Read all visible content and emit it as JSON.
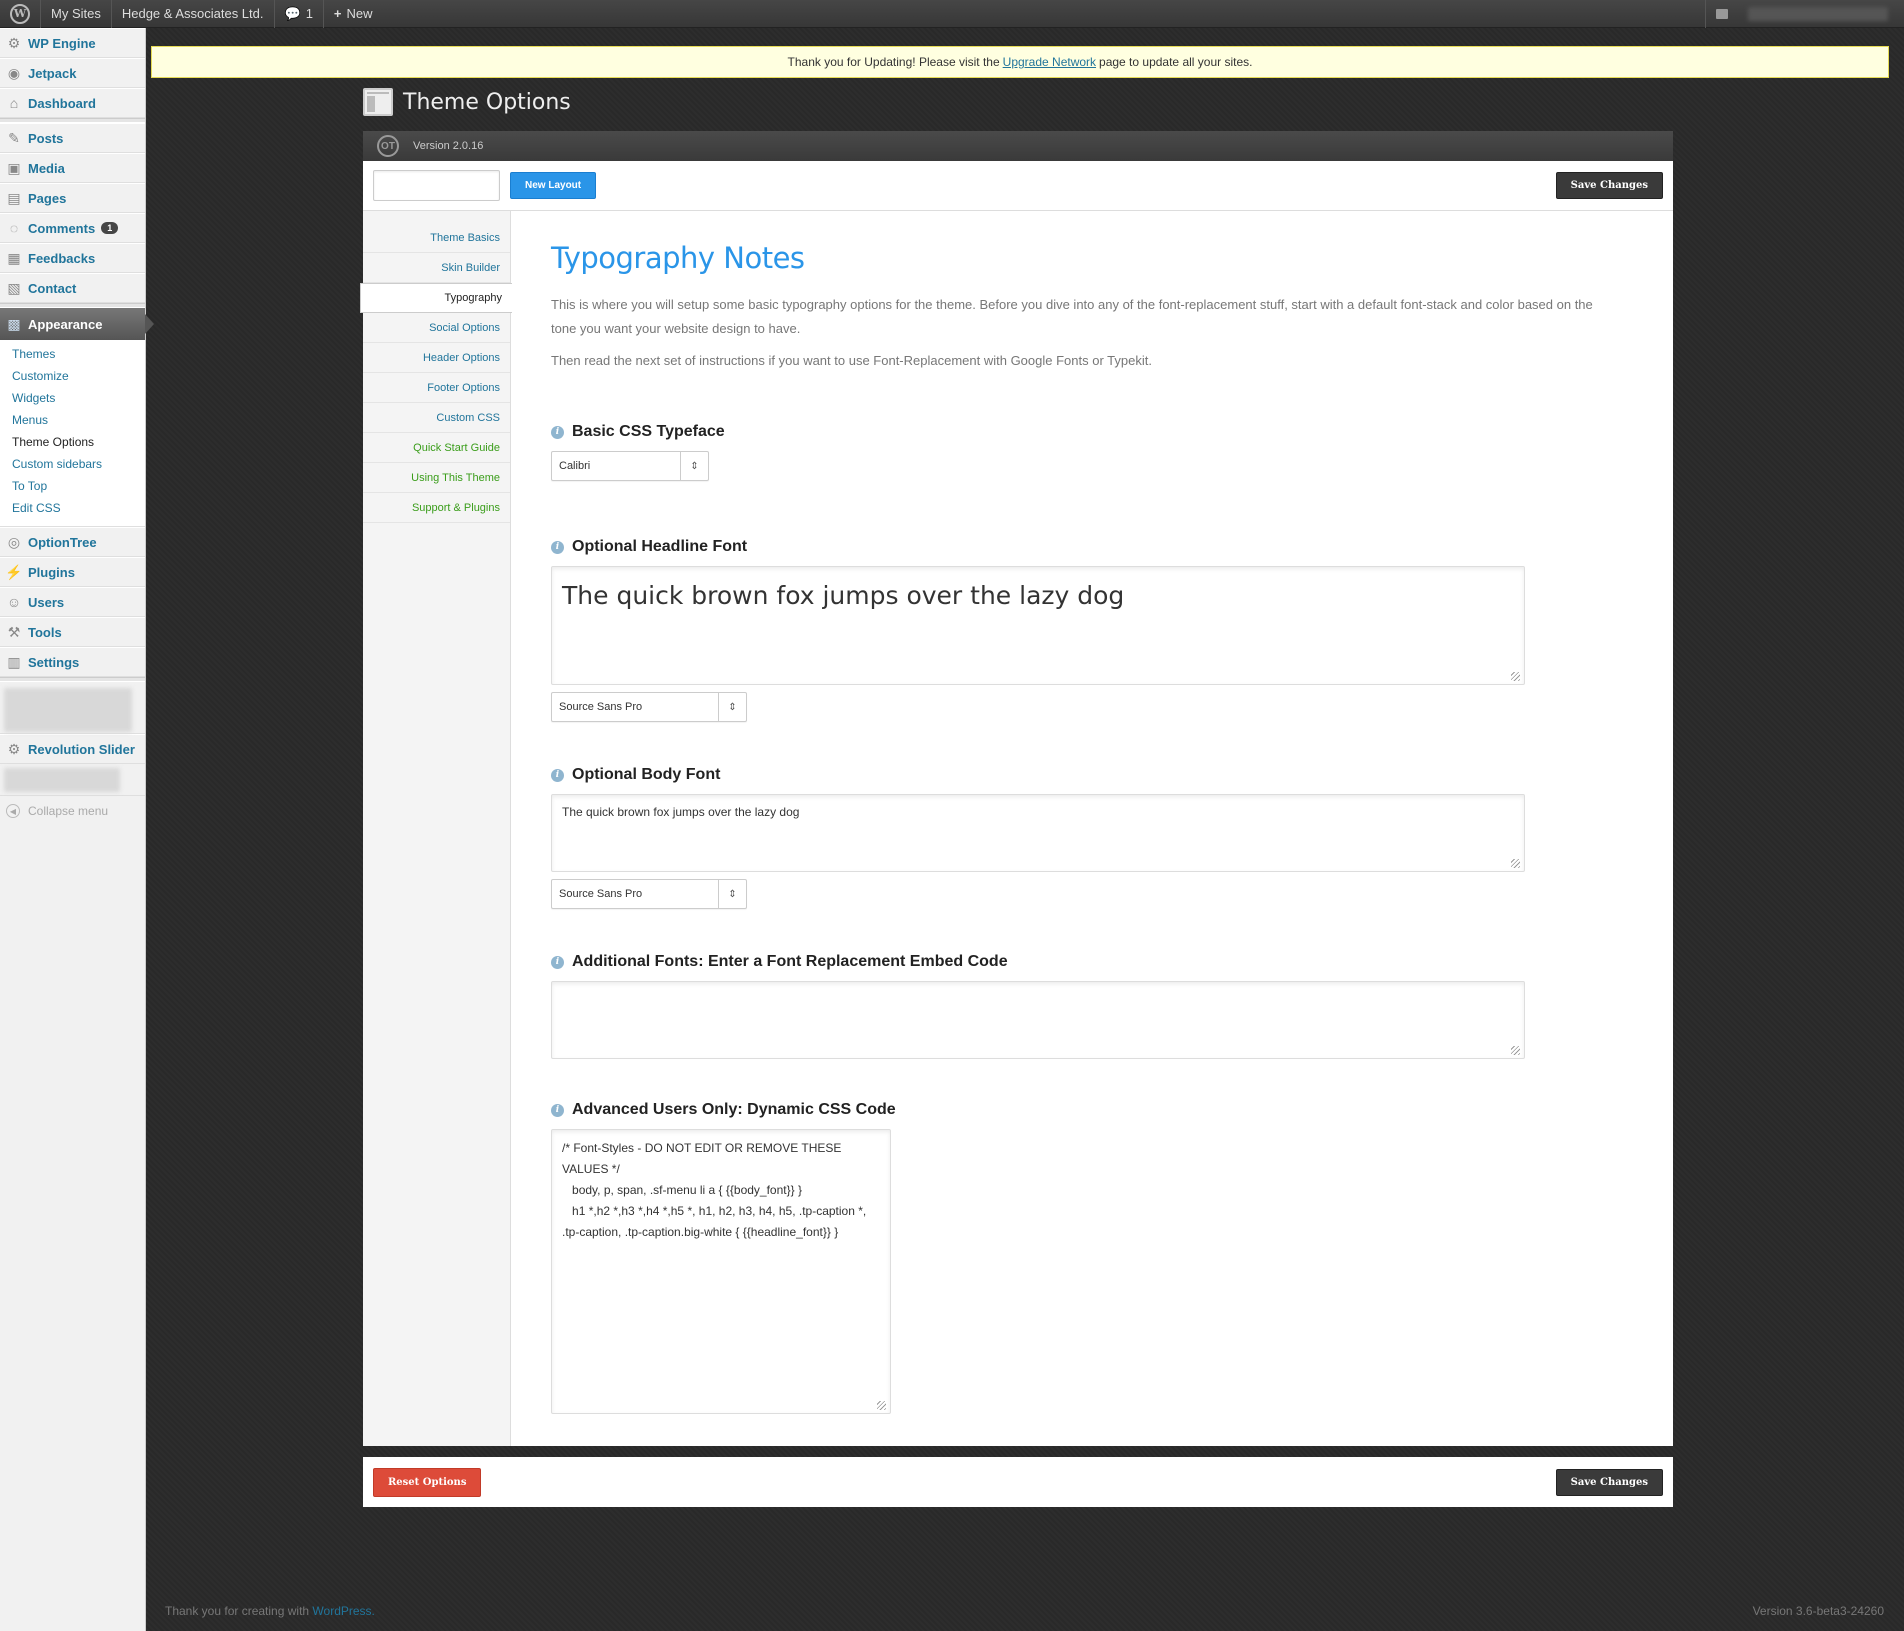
{
  "adminbar": {
    "my_sites": "My Sites",
    "site_name": "Hedge & Associates Ltd.",
    "comments_count": "1",
    "new_label": "New"
  },
  "sidebar": {
    "top": [
      {
        "label": "WP Engine",
        "icon": "gear-icon"
      },
      {
        "label": "Jetpack",
        "icon": "jetpack-icon"
      },
      {
        "label": "Dashboard",
        "icon": "house-icon"
      }
    ],
    "content": [
      {
        "label": "Posts",
        "icon": "pin-icon"
      },
      {
        "label": "Media",
        "icon": "media-icon"
      },
      {
        "label": "Pages",
        "icon": "pages-icon"
      },
      {
        "label": "Comments",
        "icon": "comment-icon",
        "badge": "1"
      },
      {
        "label": "Feedbacks",
        "icon": "feedback-icon"
      },
      {
        "label": "Contact",
        "icon": "contact-icon"
      }
    ],
    "appearance": "Appearance",
    "appearance_sub": [
      "Themes",
      "Customize",
      "Widgets",
      "Menus",
      "Theme Options",
      "Custom sidebars",
      "To Top",
      "Edit CSS"
    ],
    "bottom": [
      {
        "label": "OptionTree",
        "icon": "optiontree-icon"
      },
      {
        "label": "Plugins",
        "icon": "plugin-icon"
      },
      {
        "label": "Users",
        "icon": "users-icon"
      },
      {
        "label": "Tools",
        "icon": "tools-icon"
      },
      {
        "label": "Settings",
        "icon": "settings-icon"
      }
    ],
    "revolution": "Revolution Slider",
    "collapse": "Collapse menu"
  },
  "notice": {
    "before": "Thank you for Updating! Please visit the",
    "link": "Upgrade Network",
    "after": "page to update all your sites."
  },
  "page_title": "Theme Options",
  "panel": {
    "version": "Version 2.0.16",
    "new_layout": "New Layout",
    "save_changes": "Save Changes",
    "reset_options": "Reset Options"
  },
  "tabs": [
    {
      "label": "Theme Basics",
      "color": "blue"
    },
    {
      "label": "Skin Builder",
      "color": "blue"
    },
    {
      "label": "Typography",
      "color": "active"
    },
    {
      "label": "Social Options",
      "color": "blue"
    },
    {
      "label": "Header Options",
      "color": "blue"
    },
    {
      "label": "Footer Options",
      "color": "blue"
    },
    {
      "label": "Custom CSS",
      "color": "blue"
    },
    {
      "label": "Quick Start Guide",
      "color": "green"
    },
    {
      "label": "Using This Theme",
      "color": "green"
    },
    {
      "label": "Support & Plugins",
      "color": "green"
    }
  ],
  "section": {
    "title": "Typography Notes",
    "desc1": "This is where you will setup some basic typography options for the theme. Before you dive into any of the font-replacement stuff, start with a default font-stack and color based on the tone you want your website design to have.",
    "desc2": "Then read the next set of instructions if you want to use Font-Replacement with Google Fonts or Typekit."
  },
  "options": {
    "basic_css_label": "Basic CSS Typeface",
    "basic_css_value": "Calibri",
    "headline_label": "Optional Headline Font",
    "headline_preview": "The quick brown fox jumps over the lazy dog",
    "headline_font": "Source Sans Pro",
    "body_label": "Optional Body Font",
    "body_preview": "The quick brown fox jumps over the lazy dog",
    "body_font": "Source Sans Pro",
    "additional_label": "Additional Fonts: Enter a Font Replacement Embed Code",
    "additional_value": "",
    "advanced_label": "Advanced Users Only: Dynamic CSS Code",
    "advanced_value": "/* Font-Styles - DO NOT EDIT OR REMOVE THESE VALUES */\n   body, p, span, .sf-menu li a { {{body_font}} }\n   h1 *,h2 *,h3 *,h4 *,h5 *, h1, h2, h3, h4, h5, .tp-caption *, .tp-caption, .tp-caption.big-white { {{headline_font}} }"
  },
  "footer": {
    "thanks": "Thank you for creating with",
    "wordpress": "WordPress.",
    "version": "Version 3.6-beta3-24260"
  }
}
